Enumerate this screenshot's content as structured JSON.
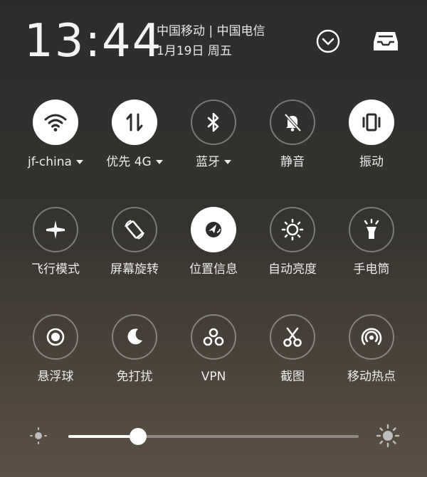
{
  "header": {
    "time": "13:44",
    "carriers": "中国移动 | 中国电信",
    "date": "1月19日 周五"
  },
  "tiles": [
    {
      "label": "jf-china",
      "icon": "wifi-icon",
      "active": true,
      "dropdown": true
    },
    {
      "label": "优先 4G",
      "icon": "mobile-data-icon",
      "active": true,
      "dropdown": true
    },
    {
      "label": "蓝牙",
      "icon": "bluetooth-icon",
      "active": false,
      "dropdown": true
    },
    {
      "label": "静音",
      "icon": "mute-icon",
      "active": false,
      "dropdown": false
    },
    {
      "label": "振动",
      "icon": "vibrate-icon",
      "active": true,
      "dropdown": false
    },
    {
      "label": "飞行模式",
      "icon": "airplane-icon",
      "active": false,
      "dropdown": false
    },
    {
      "label": "屏幕旋转",
      "icon": "rotation-icon",
      "active": false,
      "dropdown": false
    },
    {
      "label": "位置信息",
      "icon": "location-icon",
      "active": true,
      "dropdown": false
    },
    {
      "label": "自动亮度",
      "icon": "auto-brightness-icon",
      "active": false,
      "dropdown": false
    },
    {
      "label": "手电筒",
      "icon": "flashlight-icon",
      "active": false,
      "dropdown": false
    },
    {
      "label": "悬浮球",
      "icon": "floating-ball-icon",
      "active": false,
      "dropdown": false
    },
    {
      "label": "免打扰",
      "icon": "moon-icon",
      "active": false,
      "dropdown": false
    },
    {
      "label": "VPN",
      "icon": "vpn-icon",
      "active": false,
      "dropdown": false
    },
    {
      "label": "截图",
      "icon": "screenshot-scissors-icon",
      "active": false,
      "dropdown": false
    },
    {
      "label": "移动热点",
      "icon": "hotspot-icon",
      "active": false,
      "dropdown": false
    }
  ],
  "brightness": {
    "level": 0.24
  }
}
